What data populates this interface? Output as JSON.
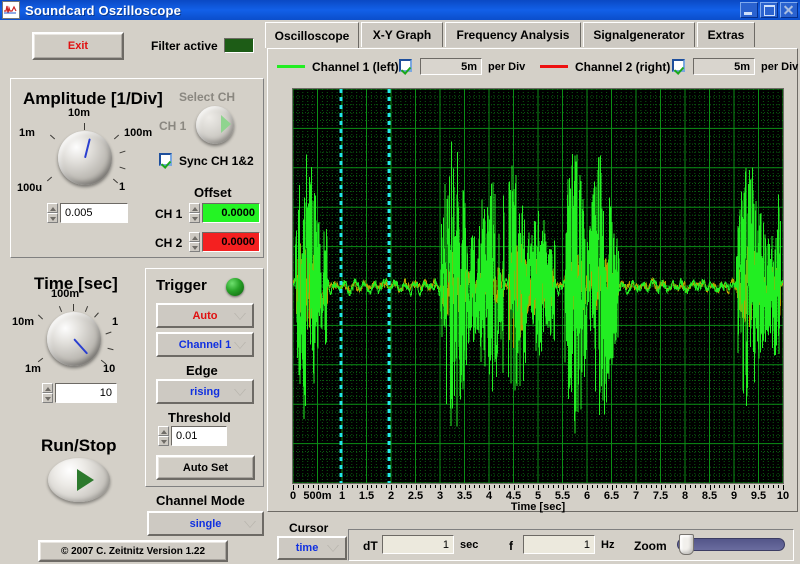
{
  "window": {
    "title": "Soundcard Oszilloscope",
    "icon": "waveform-icon",
    "minimize": "minimize-icon",
    "maximize": "maximize-icon",
    "close": "close-icon"
  },
  "toolbar": {
    "exit_label": "Exit",
    "filter_label": "Filter active",
    "filter_led_color": "#1d5c16"
  },
  "tabs": [
    {
      "label": "Oscilloscope",
      "selected": true
    },
    {
      "label": "X-Y Graph",
      "selected": false
    },
    {
      "label": "Frequency Analysis",
      "selected": false
    },
    {
      "label": "Signalgenerator",
      "selected": false
    },
    {
      "label": "Extras",
      "selected": false
    }
  ],
  "channels": [
    {
      "name": "Channel 1 (left)",
      "color": "#22ee22",
      "enabled": true,
      "per_div_value": "5m",
      "per_div_label": "per Div"
    },
    {
      "name": "Channel 2 (right)",
      "color": "#ee1111",
      "enabled": true,
      "per_div_value": "5m",
      "per_div_label": "per Div"
    }
  ],
  "amplitude": {
    "title": "Amplitude [1/Div]",
    "knob_labels": [
      "100u",
      "1m",
      "10m",
      "100m",
      "1"
    ],
    "value": "0.005",
    "select_ch_label": "Select CH",
    "select_ch_value": "CH 1",
    "sync_label": "Sync CH 1&2",
    "sync_checked": true,
    "offset_title": "Offset",
    "offsets": [
      {
        "label": "CH 1",
        "value": "0.0000",
        "color": "#24f424"
      },
      {
        "label": "CH 2",
        "value": "0.0000",
        "color": "#f42020"
      }
    ]
  },
  "time": {
    "title": "Time [sec]",
    "knob_labels": [
      "1m",
      "10m",
      "100m",
      "1",
      "10"
    ],
    "value": "10"
  },
  "trigger": {
    "title": "Trigger",
    "led_color": "#1f8a1f",
    "mode": "Auto",
    "mode_color": "#e01010",
    "source": "Channel 1",
    "source_color": "#1030e0",
    "edge_label": "Edge",
    "edge": "rising",
    "edge_color": "#1030e0",
    "threshold_label": "Threshold",
    "threshold": "0.01",
    "autoset_label": "Auto Set"
  },
  "runstop": {
    "label": "Run/Stop",
    "icon": "play-icon"
  },
  "channel_mode": {
    "label": "Channel Mode",
    "value": "single",
    "value_color": "#1030e0"
  },
  "copyright": "© 2007   C. Zeitnitz Version 1.22",
  "cursor_bar": {
    "cursor_label": "Cursor",
    "cursor_mode": "time",
    "dt_label": "dT",
    "dt_value": "1",
    "dt_unit": "sec",
    "f_label": "f",
    "f_value": "1",
    "f_unit": "Hz",
    "zoom_label": "Zoom",
    "zoom_percent": 2
  },
  "chart_data": {
    "type": "line",
    "title": "",
    "xlabel": "Time [sec]",
    "ylabel": "",
    "xlim": [
      0,
      10
    ],
    "ylim": [
      -0.025,
      0.025
    ],
    "grid": true,
    "background": "#000000",
    "grid_color": "#0b8f16",
    "minor_grid_color": "#0a5c10",
    "x_ticks": [
      "0",
      "500m",
      "1",
      "1.5",
      "2",
      "2.5",
      "3",
      "3.5",
      "4",
      "4.5",
      "5",
      "5.5",
      "6",
      "6.5",
      "7",
      "7.5",
      "8",
      "8.5",
      "9",
      "9.5",
      "10"
    ],
    "x_tick_values": [
      0,
      0.5,
      1,
      1.5,
      2,
      2.5,
      3,
      3.5,
      4,
      4.5,
      5,
      5.5,
      6,
      6.5,
      7,
      7.5,
      8,
      8.5,
      9,
      9.5,
      10
    ],
    "cursors": [
      {
        "name": "cursor-1",
        "x": 0.98,
        "color": "#24e8e8"
      },
      {
        "name": "cursor-2",
        "x": 1.96,
        "color": "#24e8e8"
      }
    ],
    "series": [
      {
        "name": "Channel 1 (left)",
        "color": "#22ee22",
        "bursts": [
          {
            "start": 0.05,
            "end": 0.7,
            "amplitude": 0.85
          },
          {
            "start": 3.02,
            "end": 4.3,
            "amplitude": 0.95
          },
          {
            "start": 4.4,
            "end": 5.35,
            "amplitude": 0.75
          },
          {
            "start": 5.55,
            "end": 6.65,
            "amplitude": 0.9
          },
          {
            "start": 9.05,
            "end": 9.95,
            "amplitude": 0.88
          }
        ],
        "baseline": 0.0,
        "noise": 0.06
      },
      {
        "name": "Channel 2 (right)",
        "color": "#b8a000",
        "bursts": [
          {
            "start": 0.05,
            "end": 0.7,
            "amplitude": 0.3
          },
          {
            "start": 3.02,
            "end": 4.3,
            "amplitude": 0.22
          },
          {
            "start": 4.4,
            "end": 5.35,
            "amplitude": 0.35
          },
          {
            "start": 5.55,
            "end": 6.65,
            "amplitude": 0.2
          },
          {
            "start": 9.05,
            "end": 9.95,
            "amplitude": 0.28
          }
        ],
        "baseline": 0.0,
        "noise": 0.05
      }
    ]
  }
}
